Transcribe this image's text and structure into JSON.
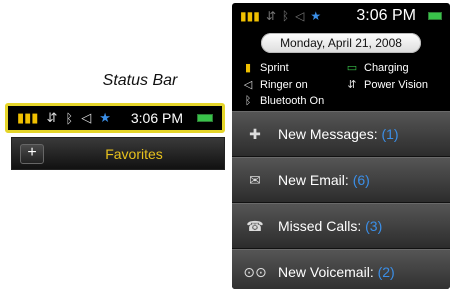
{
  "left": {
    "title": "Status Bar",
    "mini_status": {
      "time": "3:06 PM"
    },
    "header": {
      "plus": "+",
      "favorites": "Favorites"
    }
  },
  "phone": {
    "status": {
      "time": "3:06 PM"
    },
    "date": "Monday, April 21, 2008",
    "info": {
      "sprint": "Sprint",
      "charging": "Charging",
      "ringer": "Ringer on",
      "power_vision": "Power Vision",
      "bluetooth": "Bluetooth On"
    },
    "menu": [
      {
        "label": "New Messages:",
        "count": "(1)",
        "icon": "message-icon"
      },
      {
        "label": "New Email:",
        "count": "(6)",
        "icon": "email-icon"
      },
      {
        "label": "Missed Calls:",
        "count": "(3)",
        "icon": "missed-calls-icon"
      },
      {
        "label": "New Voicemail:",
        "count": "(2)",
        "icon": "voicemail-icon"
      }
    ]
  },
  "colors": {
    "accent_blue": "#3b8fe8",
    "yellow": "#e5d52a",
    "favorites_yellow": "#e8c21d",
    "battery_green": "#39c24a"
  }
}
